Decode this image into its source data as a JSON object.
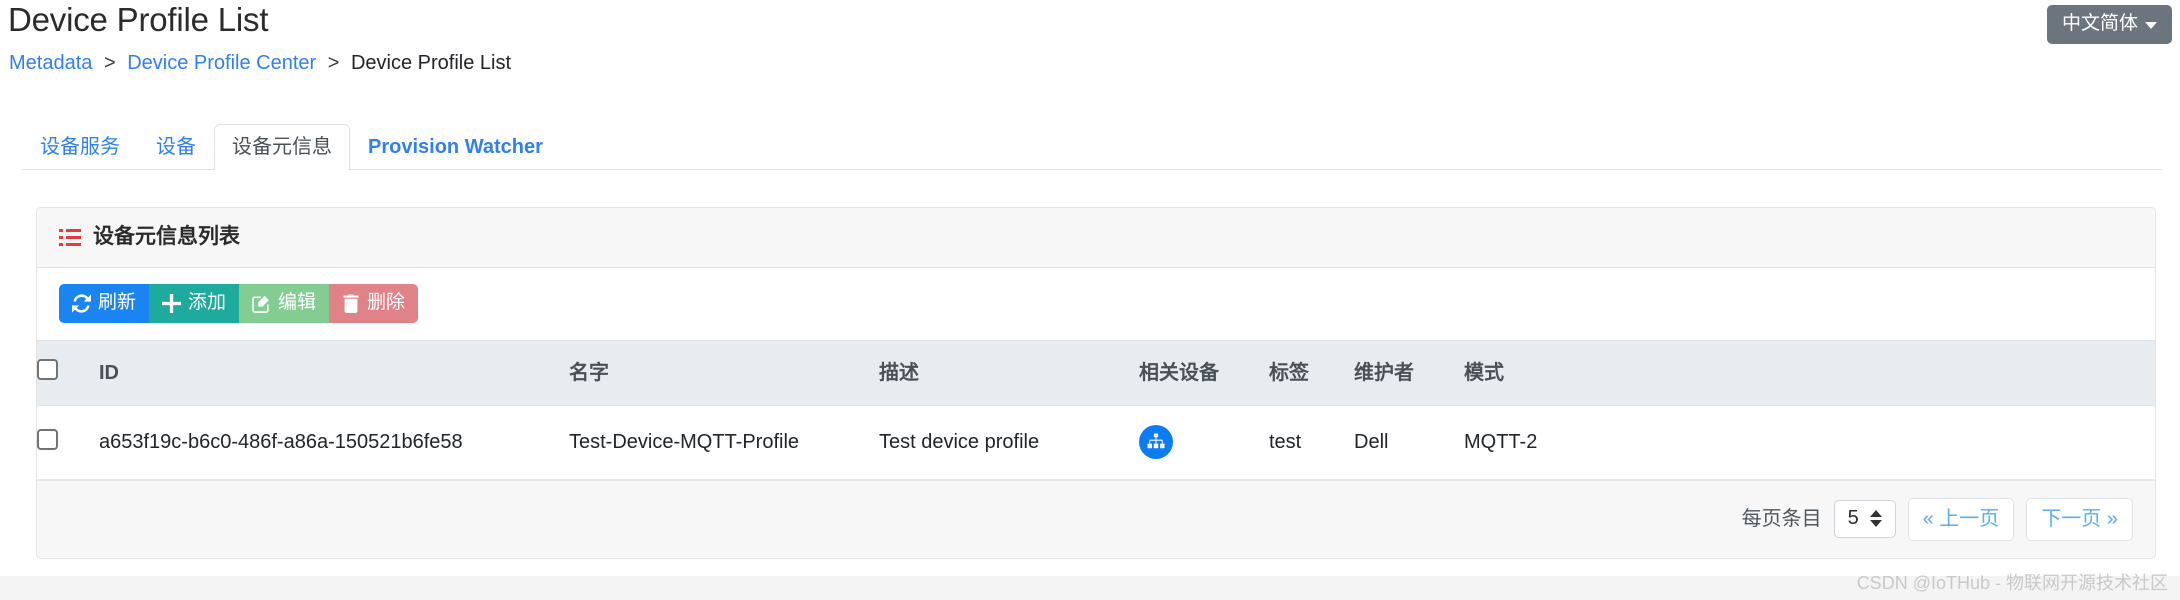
{
  "header": {
    "title": "Device Profile List",
    "breadcrumb": [
      {
        "label": "Metadata",
        "link": true
      },
      {
        "label": "Device Profile Center",
        "link": true
      },
      {
        "label": "Device Profile List",
        "link": false
      }
    ],
    "separator": ">",
    "language_button": {
      "label": "中文简体",
      "icon": "chevron-down-icon",
      "color": "#6c757d"
    }
  },
  "tabs": [
    {
      "label": "设备服务",
      "active": false,
      "bold": false
    },
    {
      "label": "设备",
      "active": false,
      "bold": false
    },
    {
      "label": "设备元信息",
      "active": true,
      "bold": false
    },
    {
      "label": "Provision Watcher",
      "active": false,
      "bold": true
    }
  ],
  "card": {
    "header_icon": "list-icon",
    "header_title": "设备元信息列表",
    "toolbar": [
      {
        "label": "刷新",
        "icon": "refresh-icon",
        "color": "#1a84f3"
      },
      {
        "label": "添加",
        "icon": "plus-icon",
        "color": "#1eab9e"
      },
      {
        "label": "编辑",
        "icon": "edit-icon",
        "color": "#83cd92"
      },
      {
        "label": "删除",
        "icon": "trash-icon",
        "color": "#e08287"
      }
    ],
    "table": {
      "select_all_checked": false,
      "columns": [
        "ID",
        "名字",
        "描述",
        "相关设备",
        "标签",
        "维护者",
        "模式"
      ],
      "rows": [
        {
          "checked": false,
          "id": "a653f19c-b6c0-486f-a86a-150521b6fe58",
          "name": "Test-Device-MQTT-Profile",
          "description": "Test device profile",
          "related_device_icon": "sitemap-icon",
          "related_device_badge_color": "#0d7cf2",
          "label": "test",
          "maintainer": "Dell",
          "model": "MQTT-2"
        }
      ]
    },
    "pagination": {
      "per_page_label": "每页条目",
      "per_page_value": "5",
      "prev_label": "« 上一页",
      "next_label": "下一页 »"
    }
  },
  "watermark": "CSDN @IoTHub - 物联网开源技术社区"
}
